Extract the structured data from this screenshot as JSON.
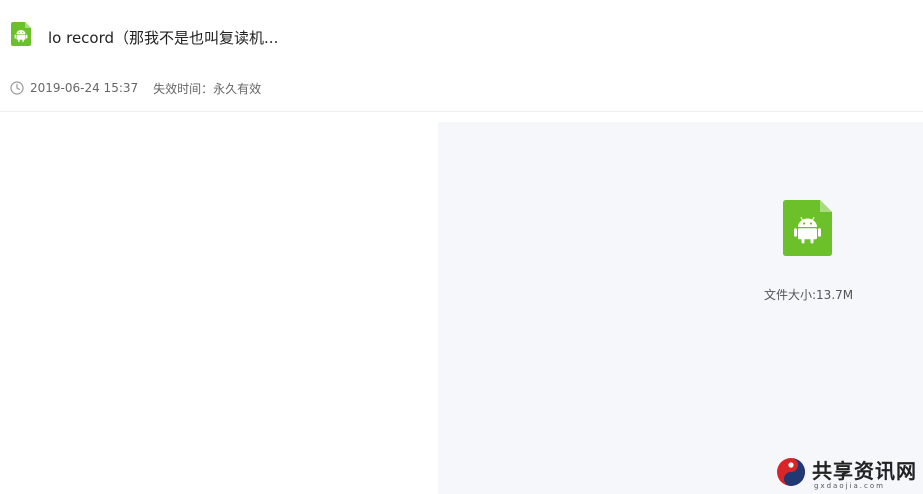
{
  "header": {
    "file_icon": "android-file-icon",
    "title": "lo record（那我不是也叫复读机...",
    "date": "2019-06-24 15:37",
    "expiry_label": "失效时间：",
    "expiry_value": "永久有效"
  },
  "preview": {
    "file_icon": "android-file-icon",
    "size_label": "文件大小:",
    "size_value": "13.7M"
  },
  "watermark": {
    "text": "共享资讯网",
    "sub": "gxdaojia.com"
  },
  "colors": {
    "android_green": "#6cc02a",
    "preview_bg": "#f5f7fb",
    "meta_text": "#666666"
  }
}
